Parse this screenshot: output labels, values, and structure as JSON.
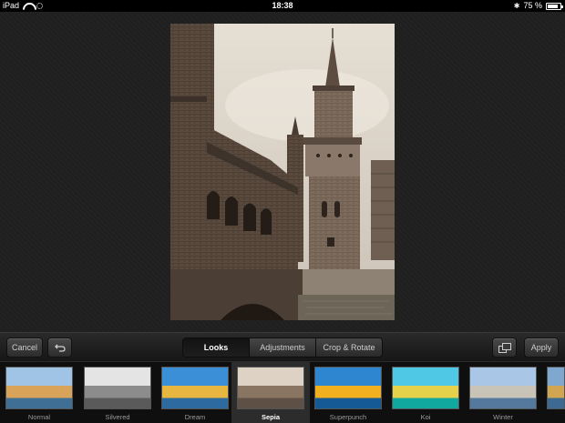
{
  "status_bar": {
    "device": "iPad",
    "time": "18:38",
    "battery": "75 %",
    "battery_level": 0.75
  },
  "toolbar": {
    "cancel_label": "Cancel",
    "apply_label": "Apply",
    "tabs": [
      {
        "label": "Looks",
        "active": true
      },
      {
        "label": "Adjustments",
        "active": false
      },
      {
        "label": "Crop & Rotate",
        "active": false
      }
    ]
  },
  "looks": [
    {
      "label": "Normal",
      "selected": false
    },
    {
      "label": "Silvered",
      "selected": false
    },
    {
      "label": "Dream",
      "selected": false
    },
    {
      "label": "Sepia",
      "selected": true
    },
    {
      "label": "Superpunch",
      "selected": false
    },
    {
      "label": "Koi",
      "selected": false
    },
    {
      "label": "Winter",
      "selected": false
    }
  ]
}
